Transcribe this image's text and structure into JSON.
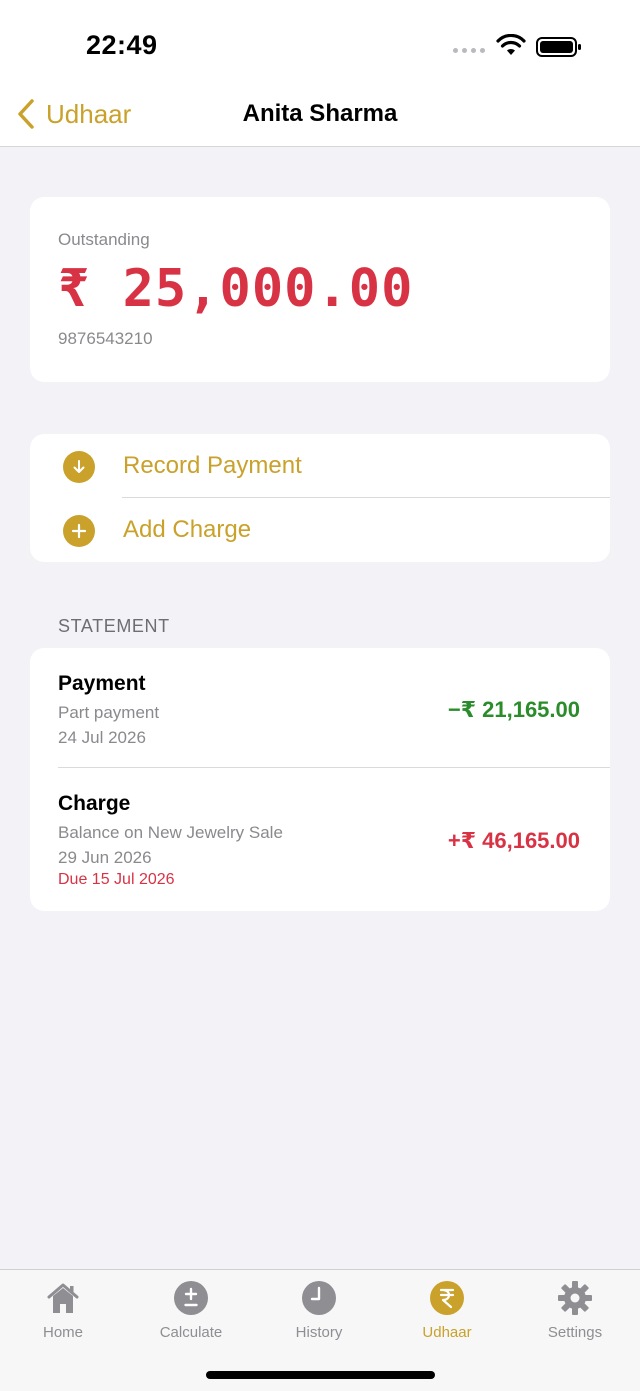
{
  "status_bar": {
    "time": "22:49"
  },
  "nav": {
    "back_label": "Udhaar",
    "title": "Anita Sharma"
  },
  "summary": {
    "label": "Outstanding",
    "amount": "₹ 25,000.00",
    "phone": "9876543210"
  },
  "actions": [
    {
      "label": "Record Payment",
      "icon": "arrow-down-circle-icon"
    },
    {
      "label": "Add Charge",
      "icon": "plus-circle-icon"
    }
  ],
  "statement": {
    "title": "STATEMENT",
    "entries": [
      {
        "type": "Payment",
        "note": "Part payment",
        "date": "24 Jul 2026",
        "amount": "−₹ 21,165.00",
        "color": "#2A8C2A"
      },
      {
        "type": "Charge",
        "note": "Balance on New Jewelry Sale",
        "date": "29 Jun 2026",
        "due": "Due 15 Jul 2026",
        "amount": "+₹ 46,165.00",
        "color": "#D83245"
      }
    ]
  },
  "tabs": [
    {
      "label": "Home",
      "icon": "house-icon",
      "active": false
    },
    {
      "label": "Calculate",
      "icon": "plus-minus-icon",
      "active": false
    },
    {
      "label": "History",
      "icon": "clock-icon",
      "active": false
    },
    {
      "label": "Udhaar",
      "icon": "rupee-icon",
      "active": true
    },
    {
      "label": "Settings",
      "icon": "gear-icon",
      "active": false
    }
  ],
  "colors": {
    "accent": "#C9A12B",
    "negative": "#D83245",
    "positive": "#2A8C2A",
    "background": "#F2F2F7"
  }
}
